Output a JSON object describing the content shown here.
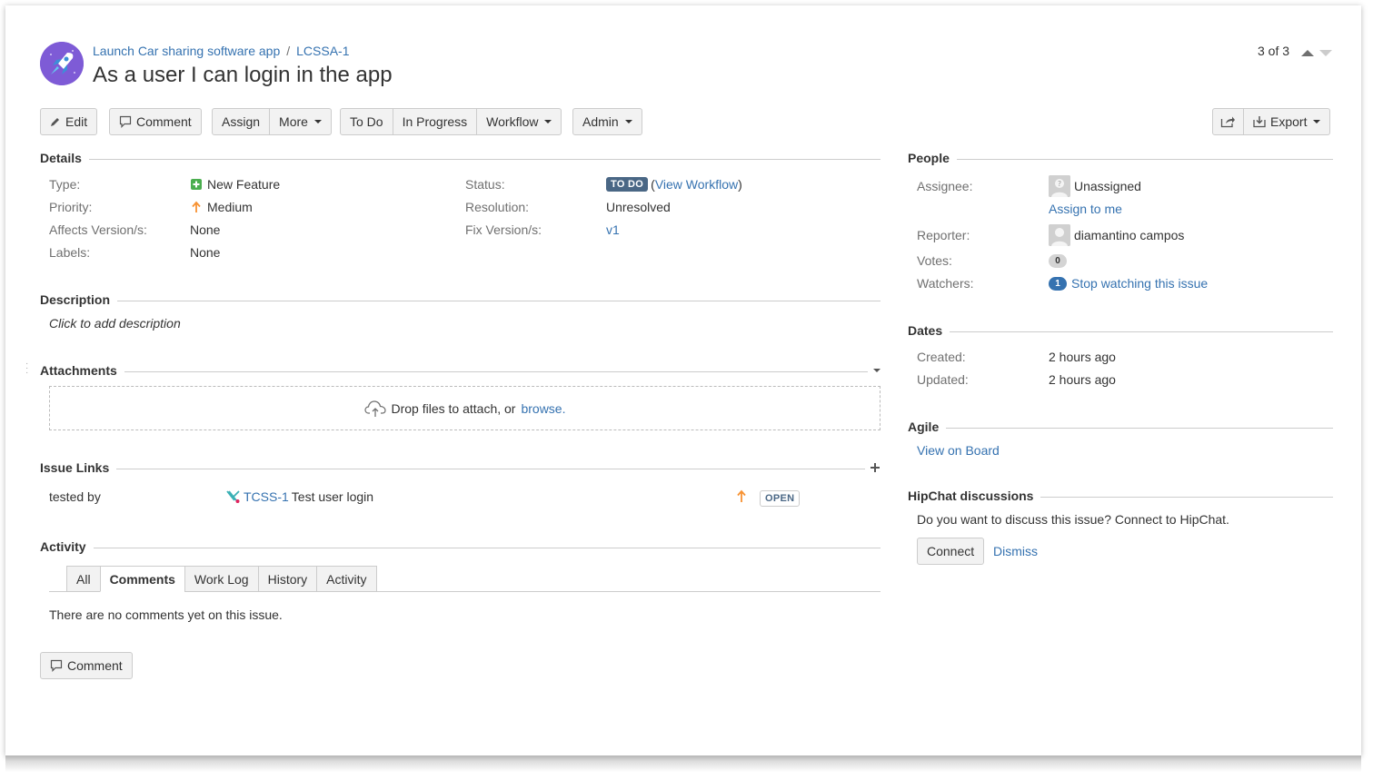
{
  "header": {
    "breadcrumb_project": "Launch Car sharing software app",
    "breadcrumb_sep": "/",
    "breadcrumb_key": "LCSSA-1",
    "summary": "As a user I can login in the app",
    "pager": "3 of 3"
  },
  "toolbar": {
    "edit": "Edit",
    "comment": "Comment",
    "assign": "Assign",
    "more": "More",
    "todo": "To Do",
    "in_progress": "In Progress",
    "workflow": "Workflow",
    "admin": "Admin",
    "export": "Export"
  },
  "details": {
    "title": "Details",
    "type_label": "Type:",
    "type_value": "New Feature",
    "priority_label": "Priority:",
    "priority_value": "Medium",
    "affects_label": "Affects Version/s:",
    "affects_value": "None",
    "labels_label": "Labels:",
    "labels_value": "None",
    "status_label": "Status:",
    "status_value": "TO DO",
    "view_workflow_open": "(",
    "view_workflow": "View Workflow",
    "view_workflow_close": ")",
    "resolution_label": "Resolution:",
    "resolution_value": "Unresolved",
    "fix_label": "Fix Version/s:",
    "fix_value": "v1"
  },
  "description": {
    "title": "Description",
    "placeholder": "Click to add description"
  },
  "attachments": {
    "title": "Attachments",
    "drop_text": "Drop files to attach, or",
    "browse": "browse."
  },
  "issue_links": {
    "title": "Issue Links",
    "relation": "tested by",
    "key": "TCSS-1",
    "summary": "Test user login",
    "status": "OPEN"
  },
  "activity": {
    "title": "Activity",
    "tabs": [
      "All",
      "Comments",
      "Work Log",
      "History",
      "Activity"
    ],
    "active_tab": "Comments",
    "empty": "There are no comments yet on this issue.",
    "comment_button": "Comment"
  },
  "people": {
    "title": "People",
    "assignee_label": "Assignee:",
    "assignee_value": "Unassigned",
    "assign_to_me": "Assign to me",
    "reporter_label": "Reporter:",
    "reporter_value": "diamantino campos",
    "votes_label": "Votes:",
    "votes_value": "0",
    "watchers_label": "Watchers:",
    "watchers_value": "1",
    "stop_watching": "Stop watching this issue"
  },
  "dates": {
    "title": "Dates",
    "created_label": "Created:",
    "created_value": "2 hours ago",
    "updated_label": "Updated:",
    "updated_value": "2 hours ago"
  },
  "agile": {
    "title": "Agile",
    "view_on_board": "View on Board"
  },
  "hipchat": {
    "title": "HipChat discussions",
    "question": "Do you want to discuss this issue? Connect to HipChat.",
    "connect": "Connect",
    "dismiss": "Dismiss"
  },
  "colors": {
    "link": "#3572b0",
    "todo_lozenge": "#4a6785",
    "new_feature": "#4bae4f",
    "priority_medium": "#f79232"
  }
}
